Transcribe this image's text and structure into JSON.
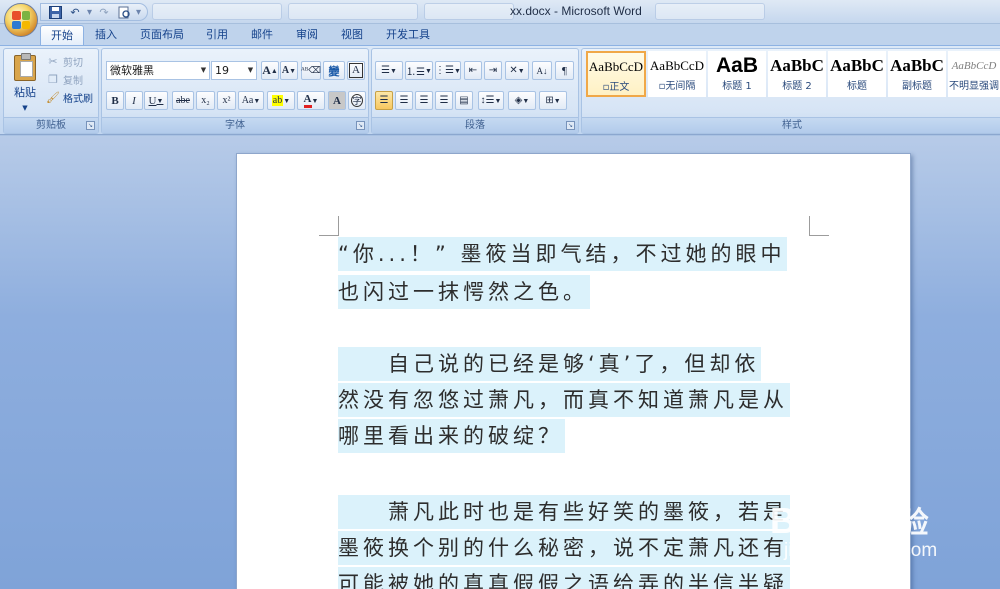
{
  "window": {
    "title": "xx.docx - Microsoft Word"
  },
  "quick_access": {
    "save": "save",
    "undo": "undo",
    "redo": "redo",
    "print_preview": "print-preview"
  },
  "ribbon_tabs": [
    "开始",
    "插入",
    "页面布局",
    "引用",
    "邮件",
    "审阅",
    "视图",
    "开发工具"
  ],
  "active_tab": "开始",
  "clipboard": {
    "group_label": "剪贴板",
    "paste": "粘贴",
    "cut": "剪切",
    "copy": "复制",
    "format_painter": "格式刷"
  },
  "font": {
    "group_label": "字体",
    "font_name": "微软雅黑",
    "font_size": "19",
    "grow": "A",
    "shrink": "A",
    "bold": "B",
    "italic": "I",
    "underline": "U",
    "strike": "abe",
    "subscript": "x₂",
    "superscript": "x²",
    "change_case": "Aa",
    "font_color": "A",
    "char_shading": "A"
  },
  "paragraph": {
    "group_label": "段落"
  },
  "styles": {
    "group_label": "样式",
    "items": [
      {
        "sample": "AaBbCcD",
        "name": "正文",
        "selected": true
      },
      {
        "sample": "AaBbCcD",
        "name": "无间隔",
        "selected": false
      },
      {
        "sample": "AaB",
        "name": "标题 1",
        "selected": false
      },
      {
        "sample": "AaBbC",
        "name": "标题 2",
        "selected": false
      },
      {
        "sample": "AaBbC",
        "name": "标题",
        "selected": false
      },
      {
        "sample": "AaBbC",
        "name": "副标题",
        "selected": false
      },
      {
        "sample": "AaBbCcD",
        "name": "不明显强调",
        "selected": false
      }
    ]
  },
  "document": {
    "paragraphs": [
      {
        "lines": [
          "“你...！” 墨筱当即气结，不过她的眼中",
          "也闪过一抹愕然之色。"
        ]
      },
      {
        "lines": [
          "　　自己说的已经是够‘真’了，但却依",
          "然没有忽悠过萧凡，而真不知道萧凡是从",
          "哪里看出来的破绽？"
        ]
      },
      {
        "lines": [
          "　　萧凡此时也是有些好笑的墨筱，若是",
          "墨筱换个别的什么秘密，说不定萧凡还有",
          "可能被她的真真假假之语给弄的半信半疑"
        ]
      }
    ]
  },
  "watermark": {
    "brand": "Bai",
    "brand_mid": "du",
    "brand_cn": "经验",
    "url": "jingyan.baidu.com"
  },
  "colors": {
    "highlight": "#dbf2fb",
    "ribbon": "#cfdff3",
    "workspace": "#8eaede"
  }
}
